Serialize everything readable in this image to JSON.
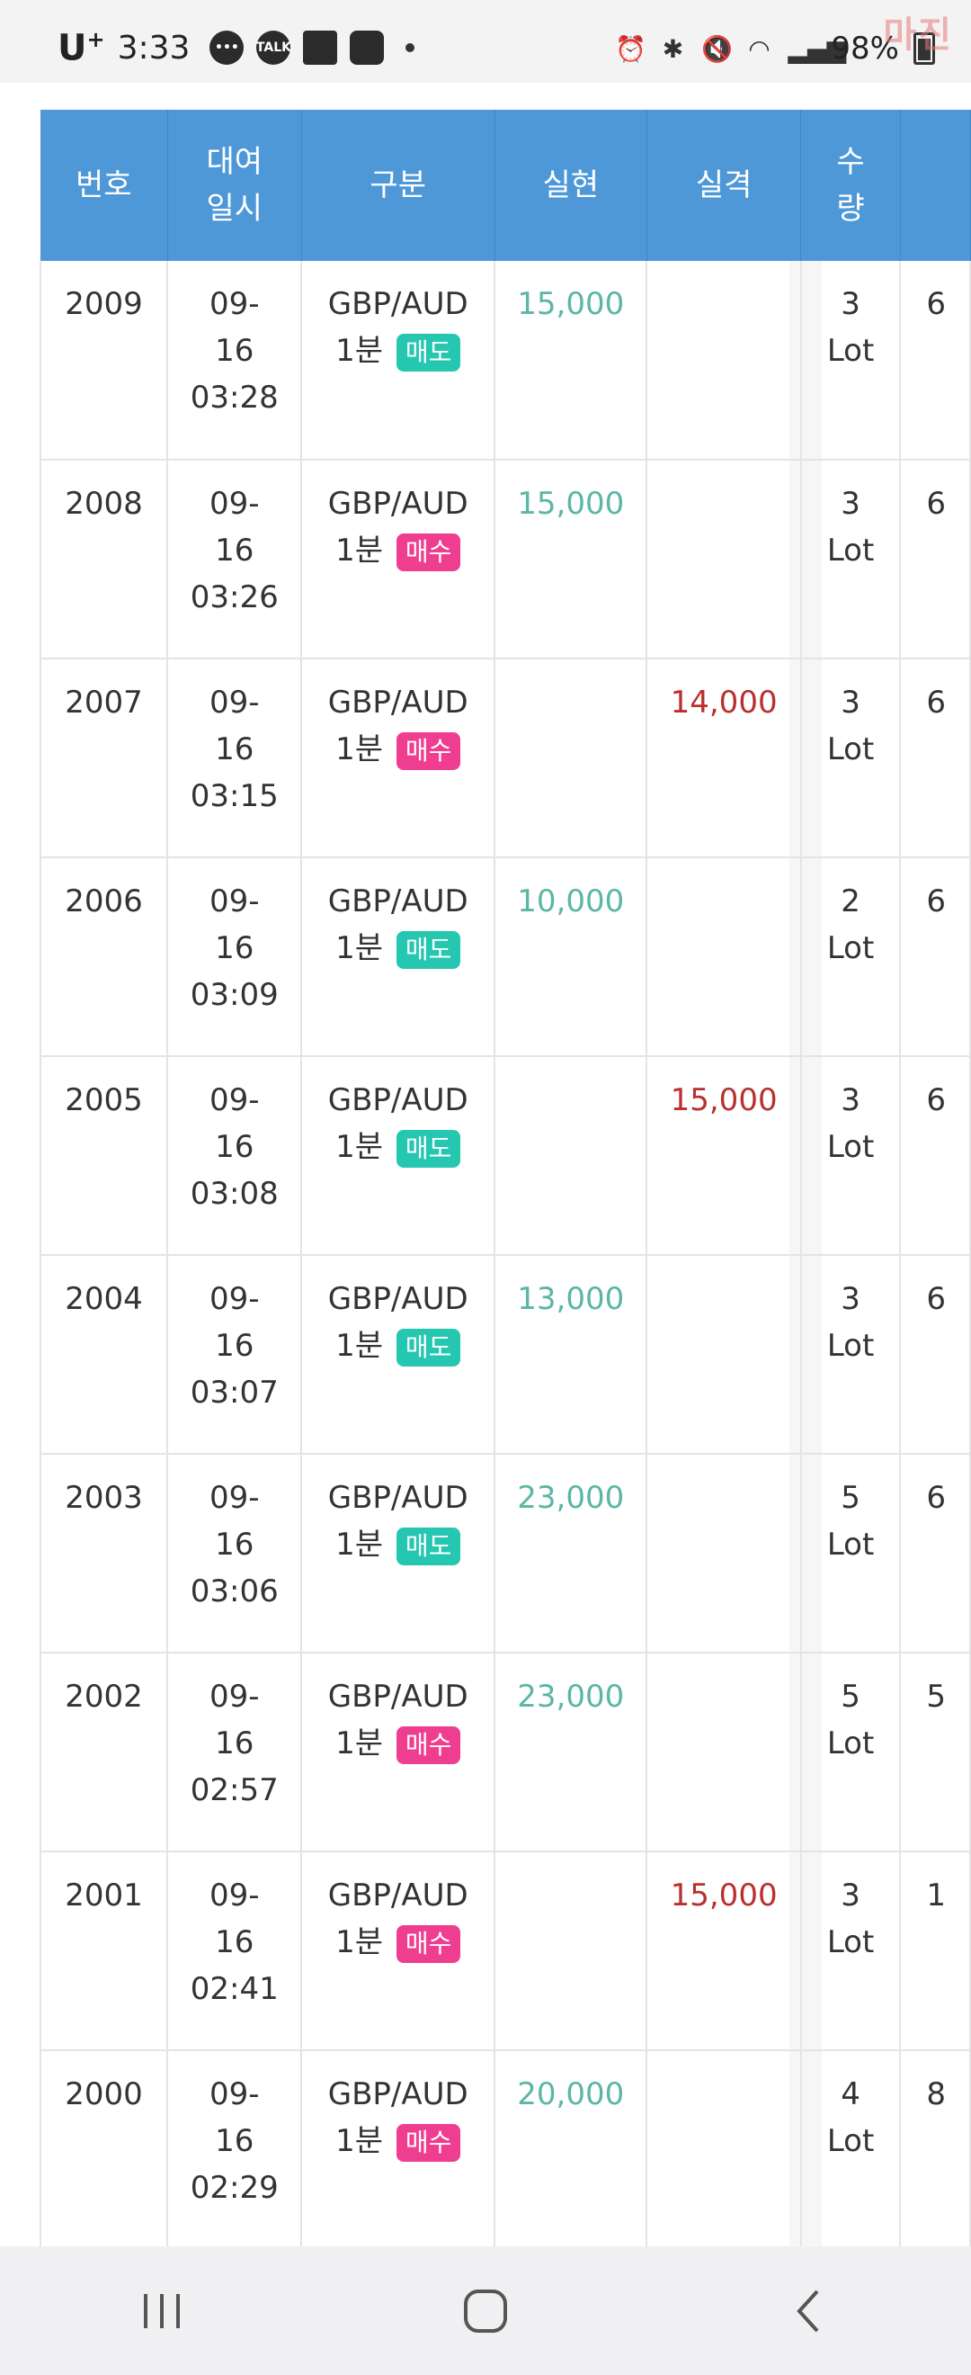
{
  "status": {
    "carrier": "U",
    "carrier_sup": "+",
    "time": "3:33",
    "talk_label": "TALK",
    "battery": "98%",
    "watermark": "마진"
  },
  "table": {
    "headers": [
      {
        "line1": "번호",
        "line2": ""
      },
      {
        "line1": "대여",
        "line2": "일시"
      },
      {
        "line1": "구분",
        "line2": ""
      },
      {
        "line1": "실현",
        "line2": ""
      },
      {
        "line1": "실격",
        "line2": ""
      },
      {
        "line1": "수",
        "line2": "량"
      }
    ],
    "rows": [
      {
        "no": "2009",
        "date": "09-",
        "day": "16",
        "time": "03:28",
        "pair": "GBP/AUD",
        "period": "1분",
        "side": "매도",
        "side_type": "sell",
        "profit": "15,000",
        "loss": "",
        "qty": "3",
        "unit": "Lot",
        "extra": "6"
      },
      {
        "no": "2008",
        "date": "09-",
        "day": "16",
        "time": "03:26",
        "pair": "GBP/AUD",
        "period": "1분",
        "side": "매수",
        "side_type": "buy",
        "profit": "15,000",
        "loss": "",
        "qty": "3",
        "unit": "Lot",
        "extra": "6"
      },
      {
        "no": "2007",
        "date": "09-",
        "day": "16",
        "time": "03:15",
        "pair": "GBP/AUD",
        "period": "1분",
        "side": "매수",
        "side_type": "buy",
        "profit": "",
        "loss": "14,000",
        "qty": "3",
        "unit": "Lot",
        "extra": "6"
      },
      {
        "no": "2006",
        "date": "09-",
        "day": "16",
        "time": "03:09",
        "pair": "GBP/AUD",
        "period": "1분",
        "side": "매도",
        "side_type": "sell",
        "profit": "10,000",
        "loss": "",
        "qty": "2",
        "unit": "Lot",
        "extra": "6"
      },
      {
        "no": "2005",
        "date": "09-",
        "day": "16",
        "time": "03:08",
        "pair": "GBP/AUD",
        "period": "1분",
        "side": "매도",
        "side_type": "sell",
        "profit": "",
        "loss": "15,000",
        "qty": "3",
        "unit": "Lot",
        "extra": "6"
      },
      {
        "no": "2004",
        "date": "09-",
        "day": "16",
        "time": "03:07",
        "pair": "GBP/AUD",
        "period": "1분",
        "side": "매도",
        "side_type": "sell",
        "profit": "13,000",
        "loss": "",
        "qty": "3",
        "unit": "Lot",
        "extra": "6"
      },
      {
        "no": "2003",
        "date": "09-",
        "day": "16",
        "time": "03:06",
        "pair": "GBP/AUD",
        "period": "1분",
        "side": "매도",
        "side_type": "sell",
        "profit": "23,000",
        "loss": "",
        "qty": "5",
        "unit": "Lot",
        "extra": "6"
      },
      {
        "no": "2002",
        "date": "09-",
        "day": "16",
        "time": "02:57",
        "pair": "GBP/AUD",
        "period": "1분",
        "side": "매수",
        "side_type": "buy",
        "profit": "23,000",
        "loss": "",
        "qty": "5",
        "unit": "Lot",
        "extra": "5"
      },
      {
        "no": "2001",
        "date": "09-",
        "day": "16",
        "time": "02:41",
        "pair": "GBP/AUD",
        "period": "1분",
        "side": "매수",
        "side_type": "buy",
        "profit": "",
        "loss": "15,000",
        "qty": "3",
        "unit": "Lot",
        "extra": "1"
      },
      {
        "no": "2000",
        "date": "09-",
        "day": "16",
        "time": "02:29",
        "pair": "GBP/AUD",
        "period": "1분",
        "side": "매수",
        "side_type": "buy",
        "profit": "20,000",
        "loss": "",
        "qty": "4",
        "unit": "Lot",
        "extra": "8"
      }
    ]
  },
  "colors": {
    "header_bg": "#4e98d8",
    "profit": "#5bb6a5",
    "loss": "#b9302e",
    "sell_badge": "#25c7b1",
    "buy_badge": "#ef3e90"
  },
  "icons": {
    "recents": "recent-apps-icon",
    "home": "home-icon",
    "back": "back-icon"
  }
}
